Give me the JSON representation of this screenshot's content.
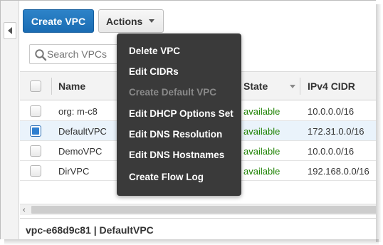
{
  "toolbar": {
    "create_label": "Create VPC",
    "actions_label": "Actions"
  },
  "search": {
    "placeholder": "Search VPCs"
  },
  "table": {
    "columns": {
      "name": "Name",
      "state": "State",
      "ipv4": "IPv4 CIDR"
    },
    "rows": [
      {
        "name": "org: m-c8",
        "state": "available",
        "ipv4": "10.0.0.0/16",
        "selected": false
      },
      {
        "name": "DefaultVPC",
        "state": "available",
        "ipv4": "172.31.0.0/16",
        "selected": true
      },
      {
        "name": "DemoVPC",
        "state": "available",
        "ipv4": "10.0.0.0/16",
        "selected": false
      },
      {
        "name": "DirVPC",
        "state": "available",
        "ipv4": "192.168.0.0/16",
        "selected": false
      }
    ]
  },
  "actions_menu": {
    "items": [
      {
        "label": "Delete VPC",
        "enabled": true
      },
      {
        "label": "Edit CIDRs",
        "enabled": true
      },
      {
        "label": "Create Default VPC",
        "enabled": false
      },
      {
        "label": "Edit DHCP Options Set",
        "enabled": true
      },
      {
        "label": "Edit DNS Resolution",
        "enabled": true
      },
      {
        "label": "Edit DNS Hostnames",
        "enabled": true
      },
      {
        "label": "Create Flow Log",
        "enabled": true
      }
    ]
  },
  "details": {
    "title": "vpc-e68d9c81 | DefaultVPC"
  },
  "colors": {
    "primary_button": "#1a6cb3",
    "available_state": "#1d8102",
    "menu_background": "#3a3a3a",
    "selected_row": "#eaf3fb"
  }
}
